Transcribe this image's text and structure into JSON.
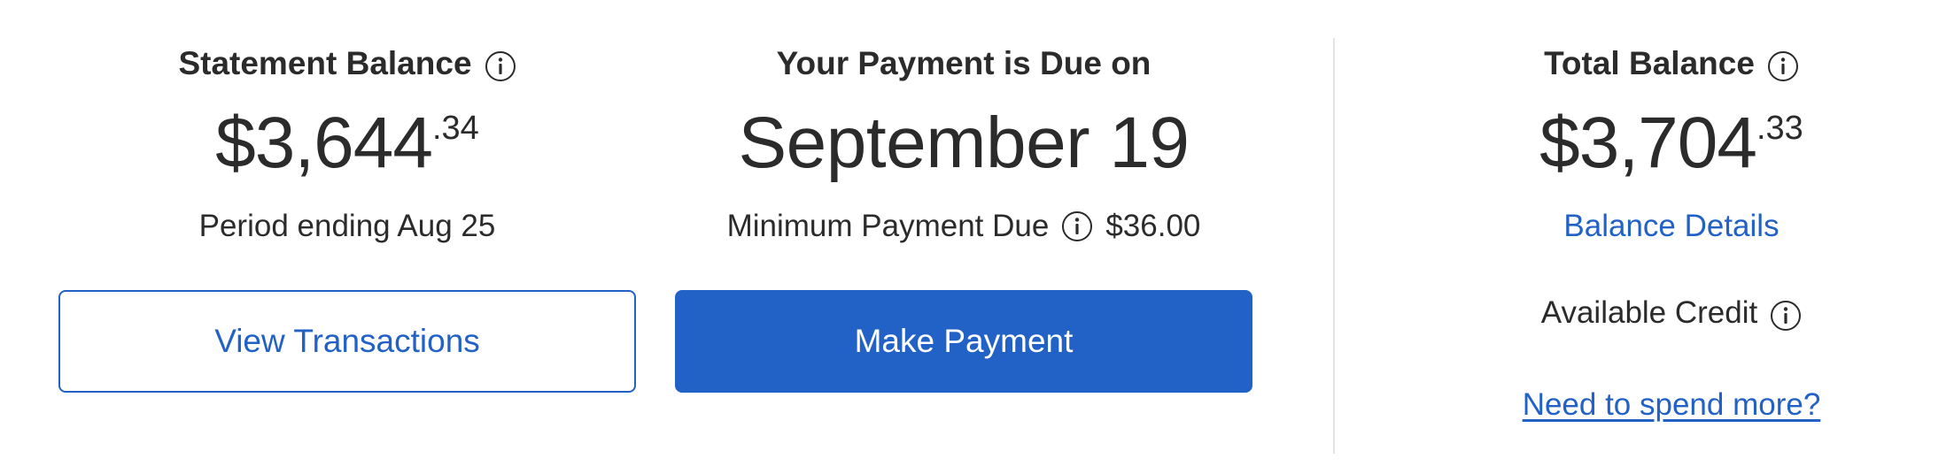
{
  "colors": {
    "accent": "#2261c5",
    "text": "#2b2b2b",
    "divider": "#e4e4e4",
    "background": "#ffffff"
  },
  "statement": {
    "title": "Statement Balance",
    "info_icon": "info-circle-icon",
    "amount_whole": "$3,644",
    "amount_cents": ".34",
    "period": "Period ending Aug 25",
    "button_label": "View Transactions"
  },
  "due": {
    "title": "Your Payment is Due on",
    "date": "September 19",
    "min_label": "Minimum Payment Due",
    "info_icon": "info-circle-icon",
    "min_amount": "$36.00",
    "button_label": "Make Payment"
  },
  "total": {
    "title": "Total Balance",
    "info_icon": "info-circle-icon",
    "amount_whole": "$3,704",
    "amount_cents": ".33",
    "details_link": "Balance Details",
    "available_label": "Available Credit",
    "spend_more_link": "Need to spend more?"
  }
}
